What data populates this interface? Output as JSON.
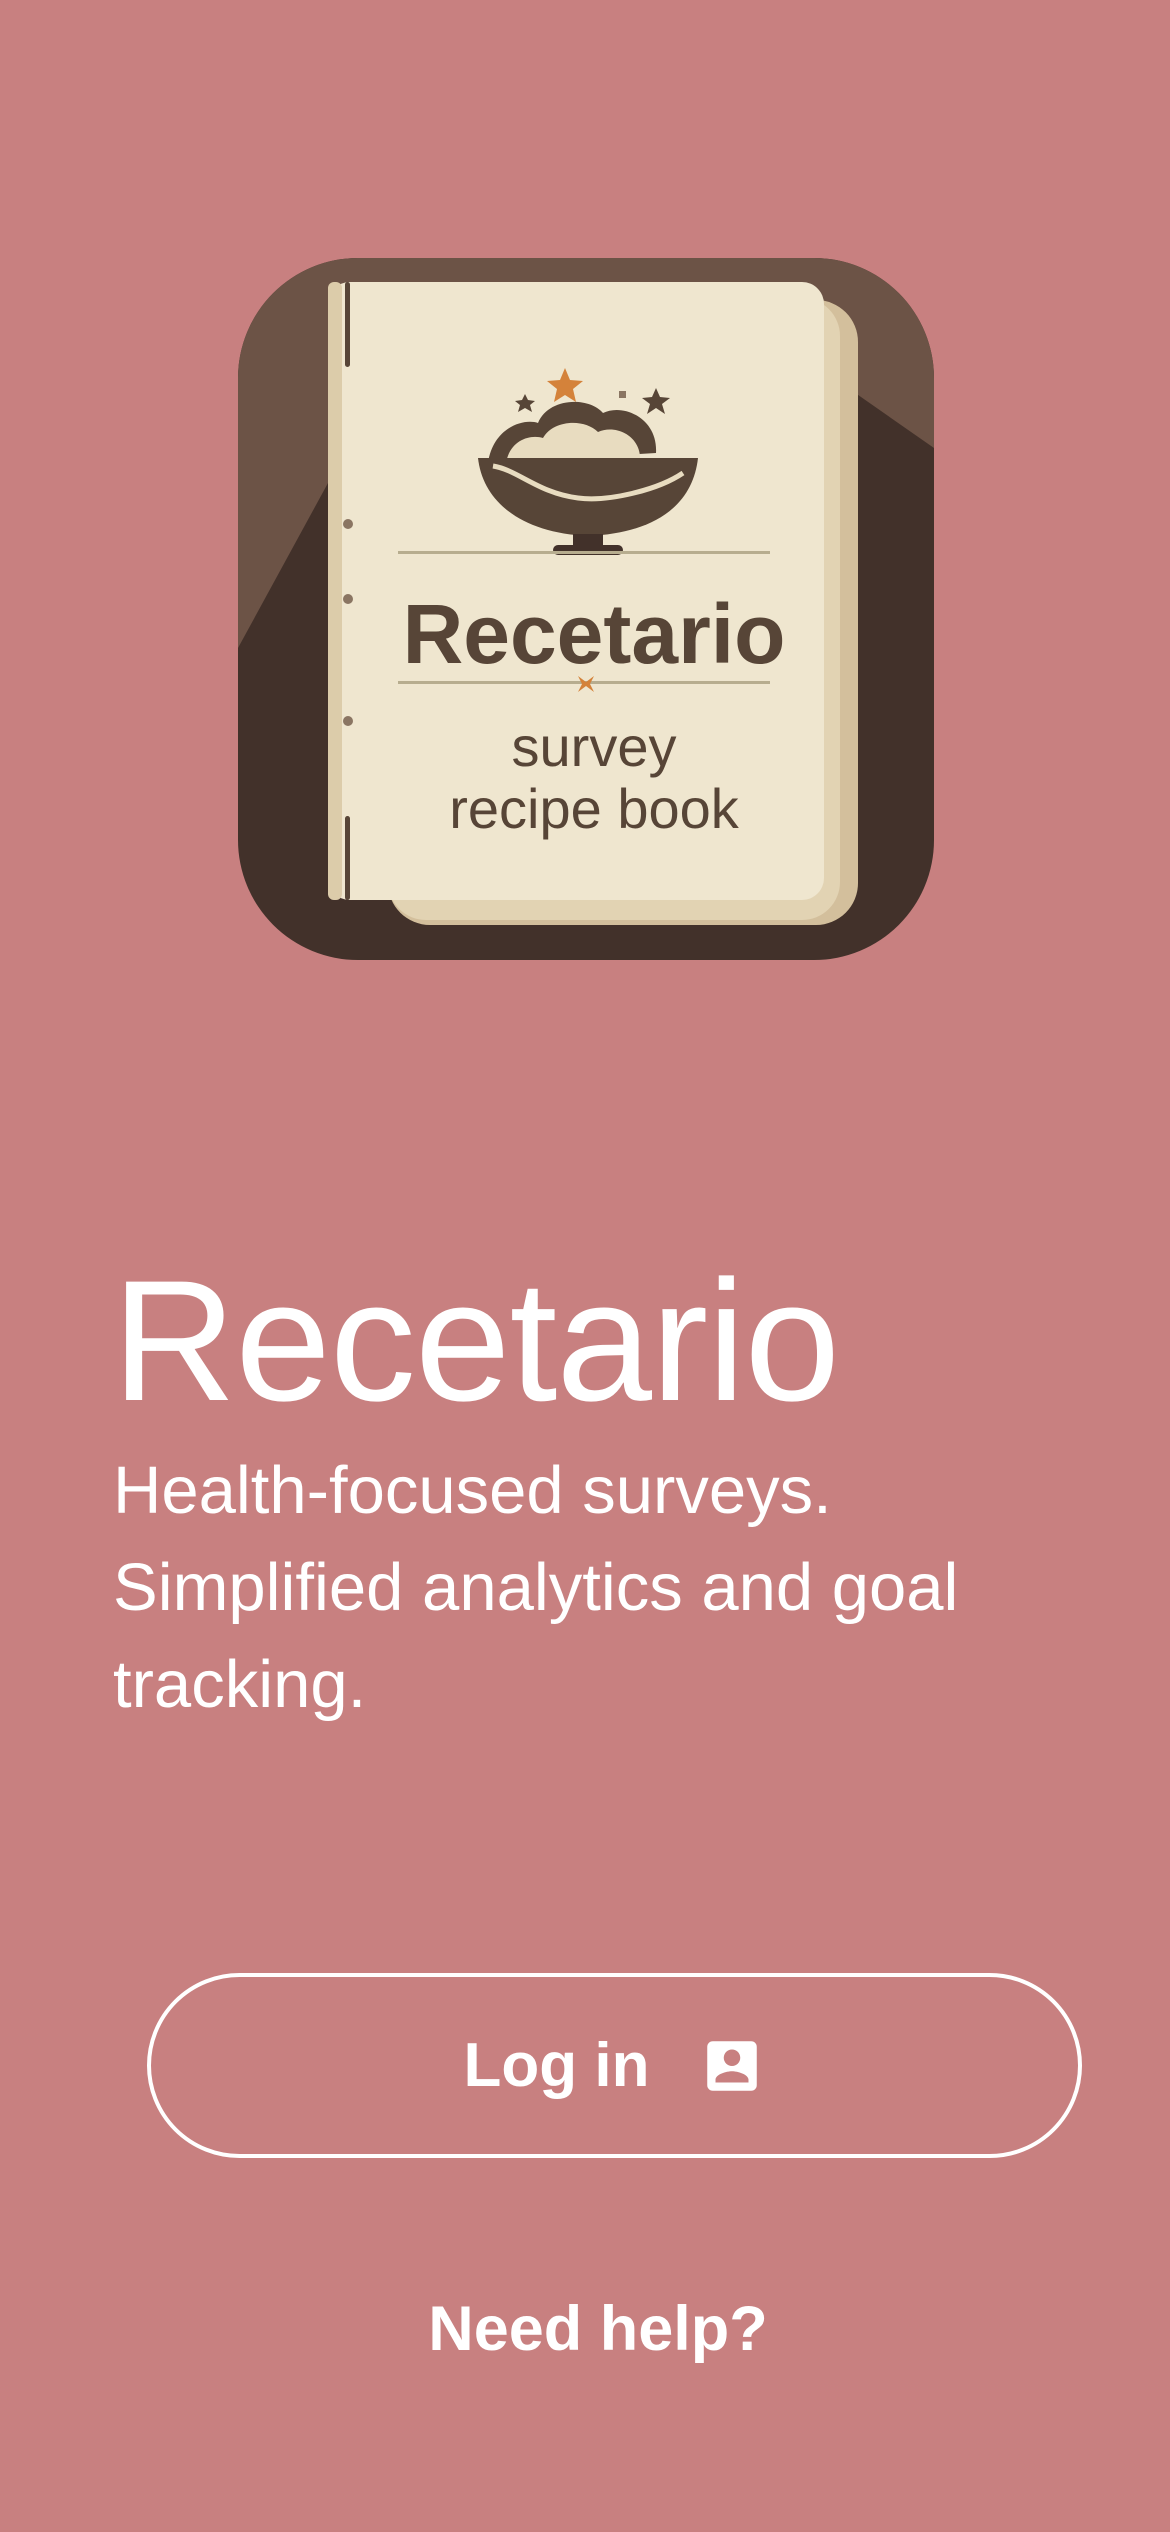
{
  "logo": {
    "title": "Recetario",
    "subtitle_line1": "survey",
    "subtitle_line2": "recipe book",
    "colors": {
      "cover_dark": "#42312A",
      "cover_mid": "#6C5346",
      "page_cream": "#EFE6CF",
      "page_edge": "#D3BF9C",
      "accent_orange": "#D4823A",
      "text_brown": "#574537"
    }
  },
  "hero": {
    "title": "Recetario",
    "tagline": "Health-focused surveys. Simplified analytics and goal tracking."
  },
  "actions": {
    "login_label": "Log in",
    "login_icon": "account-box-icon",
    "help_label": "Need help?"
  },
  "theme": {
    "background": "#C88080",
    "foreground": "#FFFFFF"
  }
}
